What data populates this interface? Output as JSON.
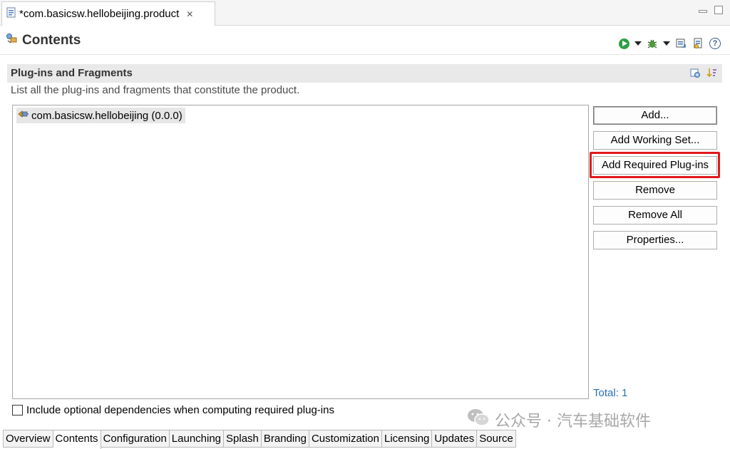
{
  "editor": {
    "tab_title": "*com.basicsw.hellobeijing.product",
    "close_symbol": "✕"
  },
  "form": {
    "title": "Contents"
  },
  "section": {
    "title": "Plug-ins and Fragments",
    "description": "List all the plug-ins and fragments that constitute the product."
  },
  "plugins": [
    {
      "label": "com.basicsw.hellobeijing (0.0.0)"
    }
  ],
  "buttons": {
    "add": "Add...",
    "add_working_set": "Add Working Set...",
    "add_required": "Add Required Plug-ins",
    "remove": "Remove",
    "remove_all": "Remove All",
    "properties": "Properties..."
  },
  "total": "Total: 1",
  "optional_checkbox": {
    "label": "Include optional dependencies when computing required plug-ins",
    "checked": false
  },
  "watermark": {
    "text": "公众号 · 汽车基础软件"
  },
  "bottom_tabs": [
    {
      "label": "Overview"
    },
    {
      "label": "Contents"
    },
    {
      "label": "Configuration"
    },
    {
      "label": "Launching"
    },
    {
      "label": "Splash"
    },
    {
      "label": "Branding"
    },
    {
      "label": "Customization"
    },
    {
      "label": "Licensing"
    },
    {
      "label": "Updates"
    },
    {
      "label": "Source"
    }
  ],
  "active_bottom_tab": "Contents",
  "colors": {
    "highlight": "#e0191b",
    "total_link": "#2a6fb5",
    "section_bg": "#e9e9e9"
  },
  "icons": {
    "editor_tab": "product-file-icon",
    "form_title": "plugins-icon",
    "plugin_item": "plugin-icon",
    "header_tools": [
      "run-icon",
      "debug-icon",
      "export-icon",
      "product-sync-icon",
      "help-icon"
    ],
    "section_tools": [
      "properties-icon",
      "sort-icon"
    ]
  }
}
